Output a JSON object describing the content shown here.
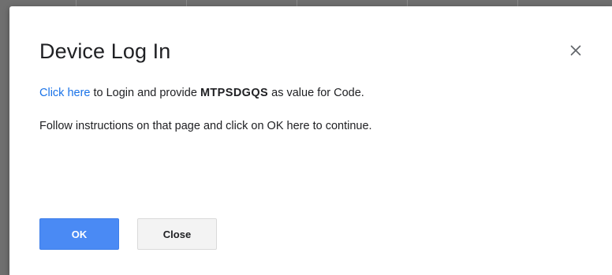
{
  "dialog": {
    "title": "Device Log In",
    "message": {
      "link_text": "Click here",
      "text_before_code": " to Login and provide ",
      "code": "MTPSDGQS",
      "text_after_code": " as value for Code."
    },
    "instructions": "Follow instructions on that page and click on OK here to continue.",
    "ok_label": "OK",
    "close_label": "Close",
    "close_icon": "close-x-icon"
  },
  "colors": {
    "accent": "#4a8af4",
    "link": "#1a73e8",
    "text": "#202124"
  }
}
